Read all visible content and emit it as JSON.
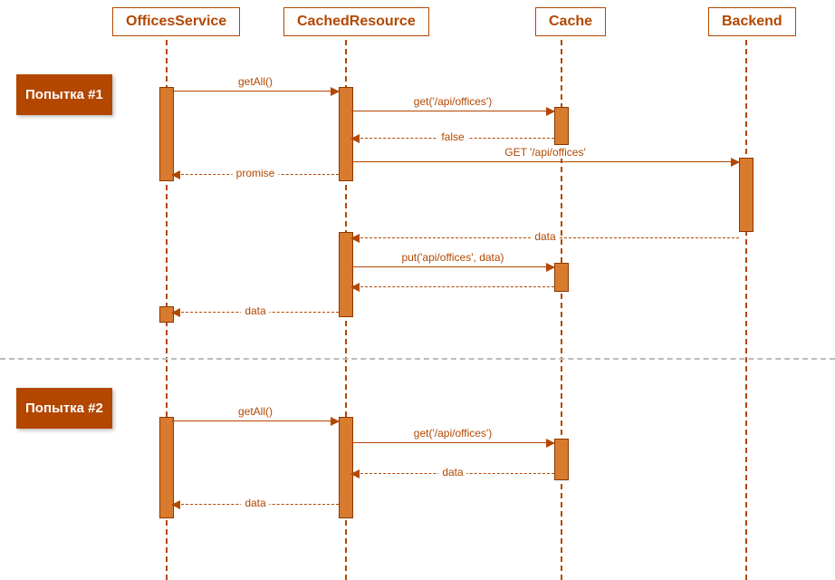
{
  "participants": {
    "offices": "OfficesService",
    "cached": "CachedResource",
    "cache": "Cache",
    "backend": "Backend"
  },
  "attempts": {
    "a1": "Попытка #1",
    "a2": "Попытка #2"
  },
  "messages": {
    "getAll": "getAll()",
    "getApi": "get('/api/offices')",
    "false": "false",
    "httpGet": "GET '/api/offices'",
    "promise": "promise",
    "data": "data",
    "putApi": "put('api/offices', data)"
  },
  "colors": {
    "brand": "#b34700"
  },
  "diagram": {
    "type": "sequence",
    "participants": [
      "OfficesService",
      "CachedResource",
      "Cache",
      "Backend"
    ],
    "sections": [
      {
        "label": "Попытка #1",
        "steps": [
          {
            "from": "OfficesService",
            "to": "CachedResource",
            "kind": "call",
            "text": "getAll()"
          },
          {
            "from": "CachedResource",
            "to": "Cache",
            "kind": "call",
            "text": "get('/api/offices')"
          },
          {
            "from": "Cache",
            "to": "CachedResource",
            "kind": "return",
            "text": "false"
          },
          {
            "from": "CachedResource",
            "to": "Backend",
            "kind": "call",
            "text": "GET '/api/offices'"
          },
          {
            "from": "CachedResource",
            "to": "OfficesService",
            "kind": "return",
            "text": "promise"
          },
          {
            "from": "Backend",
            "to": "CachedResource",
            "kind": "return",
            "text": "data"
          },
          {
            "from": "CachedResource",
            "to": "Cache",
            "kind": "call",
            "text": "put('api/offices', data)"
          },
          {
            "from": "Cache",
            "to": "CachedResource",
            "kind": "return",
            "text": ""
          },
          {
            "from": "CachedResource",
            "to": "OfficesService",
            "kind": "return",
            "text": "data"
          }
        ]
      },
      {
        "label": "Попытка #2",
        "steps": [
          {
            "from": "OfficesService",
            "to": "CachedResource",
            "kind": "call",
            "text": "getAll()"
          },
          {
            "from": "CachedResource",
            "to": "Cache",
            "kind": "call",
            "text": "get('/api/offices')"
          },
          {
            "from": "Cache",
            "to": "CachedResource",
            "kind": "return",
            "text": "data"
          },
          {
            "from": "CachedResource",
            "to": "OfficesService",
            "kind": "return",
            "text": "data"
          }
        ]
      }
    ]
  }
}
